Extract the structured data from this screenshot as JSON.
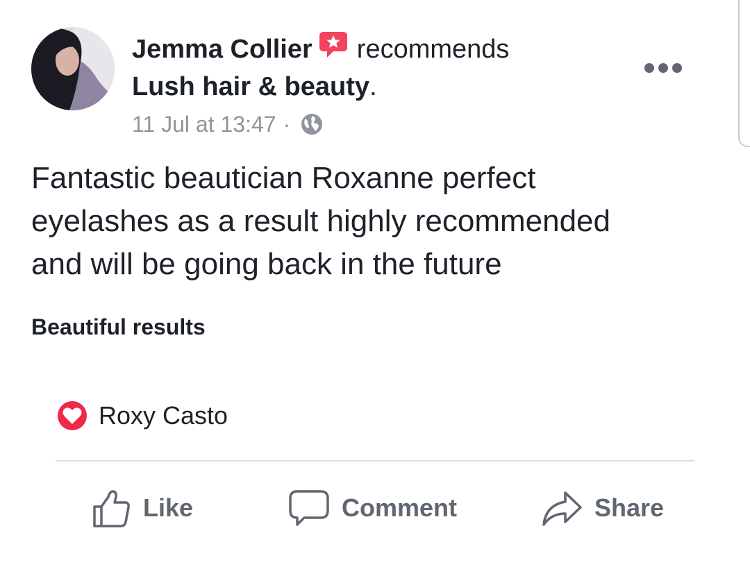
{
  "post": {
    "author": "Jemma Collier",
    "recommends_word": "recommends",
    "page_name": "Lush hair & beauty",
    "page_suffix": ".",
    "timestamp": "11 Jul at 13:47",
    "separator": "·",
    "privacy_icon": "globe-icon",
    "more_icon": "more-options-icon",
    "body_lines": [
      "Fantastic beautician Roxanne perfect",
      "eyelashes as a result highly recommended",
      "and will be going back in the future"
    ],
    "tag": "Beautiful results"
  },
  "reactions": {
    "icon": "love-reaction-icon",
    "names": "Roxy Casto"
  },
  "actions": {
    "like_label": "Like",
    "comment_label": "Comment",
    "share_label": "Share"
  },
  "colors": {
    "text": "#1d2129",
    "secondary": "#90949c",
    "action": "#606770",
    "recommend_red": "#f3425f",
    "divider": "#dadde1"
  }
}
